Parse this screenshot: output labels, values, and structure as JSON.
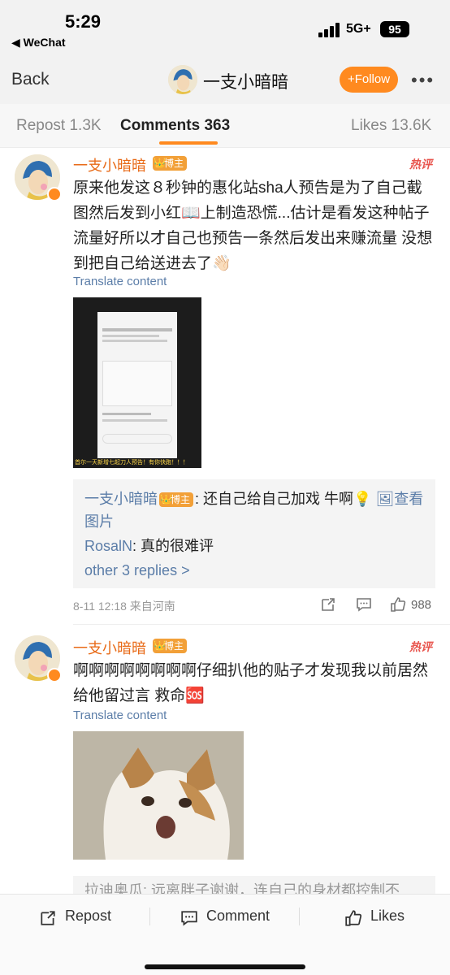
{
  "status": {
    "time": "5:29",
    "back_app": "◀ WeChat",
    "network": "5G+",
    "battery": "95"
  },
  "nav": {
    "back_label": "Back",
    "title": "一支小暗暗",
    "follow_label": "+Follow",
    "more_label": "•••"
  },
  "tabs": [
    {
      "label": "Repost 1.3K"
    },
    {
      "label": "Comments 363"
    },
    {
      "label": "Likes 13.6K"
    }
  ],
  "comments": [
    {
      "username": "一支小暗暗",
      "badge": "博主",
      "hot_tag": "热评",
      "text": "原来他发这８秒钟的惠化站sha人预告是为了自己截图然后发到小红📖上制造恐慌...估计是看发这种帖子流量好所以才自己也预告一条然后发出来赚流量 没想到把自己给送进去了👋🏻",
      "translate": "Translate content",
      "image_caption": "首尔一天新增七起刀人预告！有你快跑！！！",
      "replies": [
        {
          "user": "一支小暗暗",
          "badge": "博主",
          "text": ": 还自己给自己加戏 牛啊💡",
          "link": "🖼查看"
        },
        {
          "cont": "图片"
        },
        {
          "user": "RosalN",
          "text": ": 真的很难评"
        },
        {
          "more": "other 3 replies >"
        }
      ],
      "meta": "8-11 12:18  来自河南",
      "likes": "988"
    },
    {
      "username": "一支小暗暗",
      "badge": "博主",
      "hot_tag": "热评",
      "text": "啊啊啊啊啊啊啊啊仔细扒他的贴子才发现我以前居然给他留过言 救命🆘",
      "translate": "Translate content",
      "faded_reply": "拉迪奥瓜: 远离胖子谢谢，连自己的身材都控制不"
    }
  ],
  "bottom": {
    "repost": "Repost",
    "comment": "Comment",
    "likes": "Likes"
  },
  "colors": {
    "accent": "#ff8a1f",
    "username": "#e86a17",
    "link": "#5b7da8",
    "hot": "#e8554e"
  }
}
